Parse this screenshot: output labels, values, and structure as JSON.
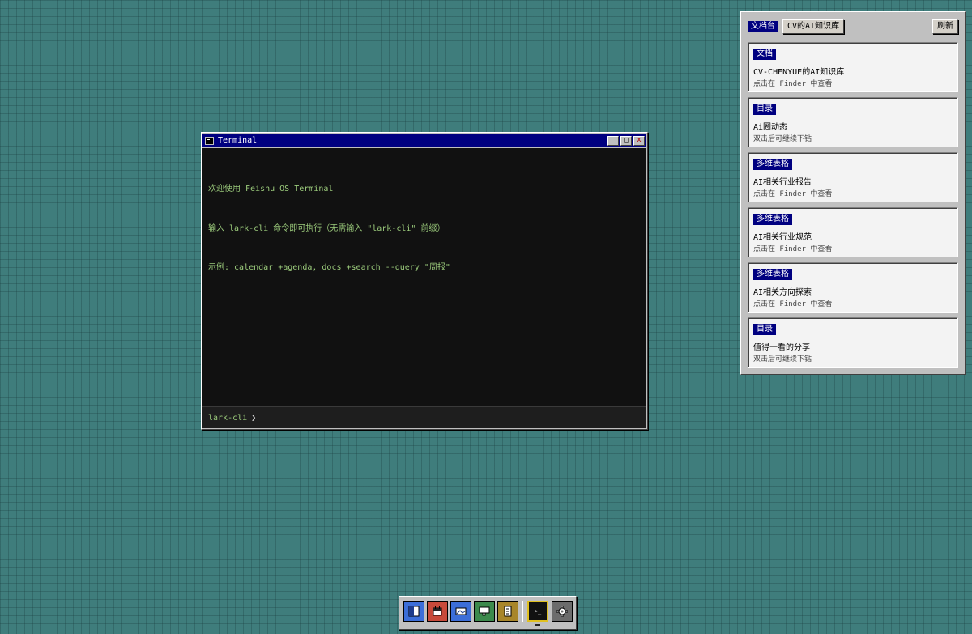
{
  "terminal": {
    "title": "Terminal",
    "lines": [
      "欢迎使用 Feishu OS Terminal",
      "输入 lark-cli 命令即可执行（无需输入 \"lark-cli\" 前缀）",
      "示例: calendar +agenda, docs +search --query \"周报\""
    ],
    "prompt": "lark-cli",
    "prompt_symbol": "❯",
    "buttons": {
      "minimize": "_",
      "maximize": "□",
      "close": "x"
    }
  },
  "panel": {
    "label": "文档台",
    "knowledge_base": "CV的AI知识库",
    "refresh": "刷新",
    "cards": [
      {
        "type": "文档",
        "title": "CV-CHENYUE的AI知识库",
        "hint": "点击在 Finder 中查看"
      },
      {
        "type": "目录",
        "title": "Ai圈动态",
        "hint": "双击后可继续下钻"
      },
      {
        "type": "多维表格",
        "title": "AI相关行业报告",
        "hint": "点击在 Finder 中查看"
      },
      {
        "type": "多维表格",
        "title": "AI相关行业规范",
        "hint": "点击在 Finder 中查看"
      },
      {
        "type": "多维表格",
        "title": "AI相关方向探索",
        "hint": "点击在 Finder 中查看"
      },
      {
        "type": "目录",
        "title": "值得一看的分享",
        "hint": "双击后可继续下钻"
      }
    ]
  },
  "dock": {
    "items": [
      {
        "icon": "finder-icon",
        "color": "#3c6ed8"
      },
      {
        "icon": "calendar-icon",
        "color": "#c84a3a"
      },
      {
        "icon": "photos-icon",
        "color": "#3c6ed8"
      },
      {
        "icon": "chat-icon",
        "color": "#3c8a4c"
      },
      {
        "icon": "notes-icon",
        "color": "#a8862a"
      },
      {
        "icon": "terminal-icon",
        "color": "#111111"
      },
      {
        "icon": "settings-icon",
        "color": "#6c6c6c"
      }
    ],
    "terminal_glyph": ">_"
  }
}
